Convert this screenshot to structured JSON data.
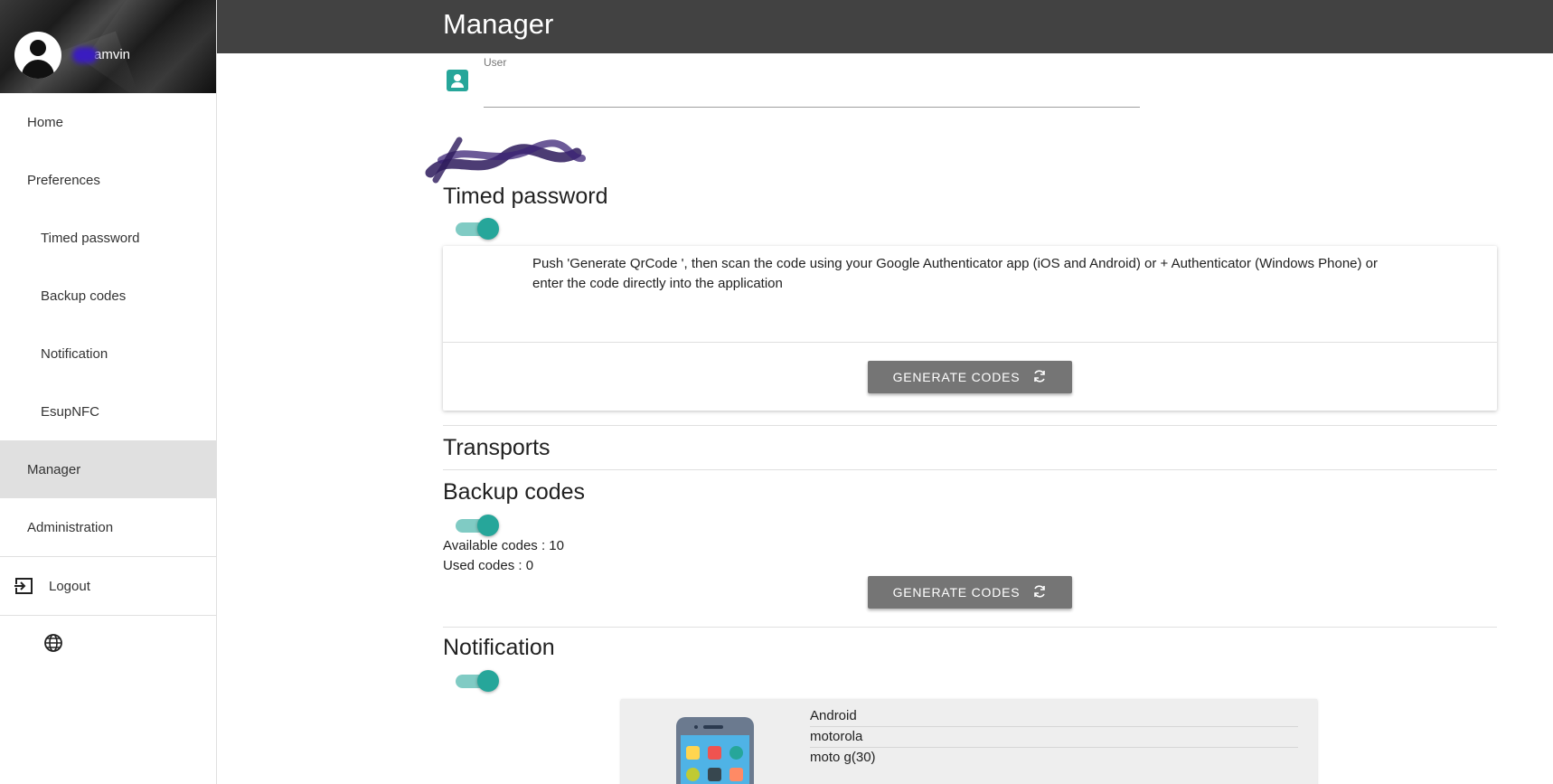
{
  "sidebar": {
    "username": "amvin",
    "items": [
      {
        "label": "Home"
      },
      {
        "label": "Preferences"
      },
      {
        "label": "Timed password"
      },
      {
        "label": "Backup codes"
      },
      {
        "label": "Notification"
      },
      {
        "label": "EsupNFC"
      },
      {
        "label": "Manager"
      },
      {
        "label": "Administration"
      }
    ],
    "logout_label": "Logout"
  },
  "header": {
    "title": "Manager"
  },
  "user_field": {
    "label": "User",
    "value": ""
  },
  "timed_password": {
    "title": "Timed password",
    "enabled": true,
    "instructions": "Push 'Generate QrCode ', then scan the code using your Google Authenticator app (iOS and Android) or + Authenticator (Windows Phone) or enter the code directly into the application",
    "button_label": "GENERATE CODES"
  },
  "transports": {
    "title": "Transports"
  },
  "backup_codes": {
    "title": "Backup codes",
    "enabled": true,
    "available": "Available codes : 10",
    "used": "Used codes : 0",
    "button_label": "GENERATE CODES"
  },
  "notification": {
    "title": "Notification",
    "enabled": true,
    "device": {
      "platform": "Android",
      "manufacturer": "motorola",
      "model": "moto g(30)"
    }
  },
  "colors": {
    "accent": "#26a69a",
    "header": "#424242",
    "button": "#757575"
  }
}
